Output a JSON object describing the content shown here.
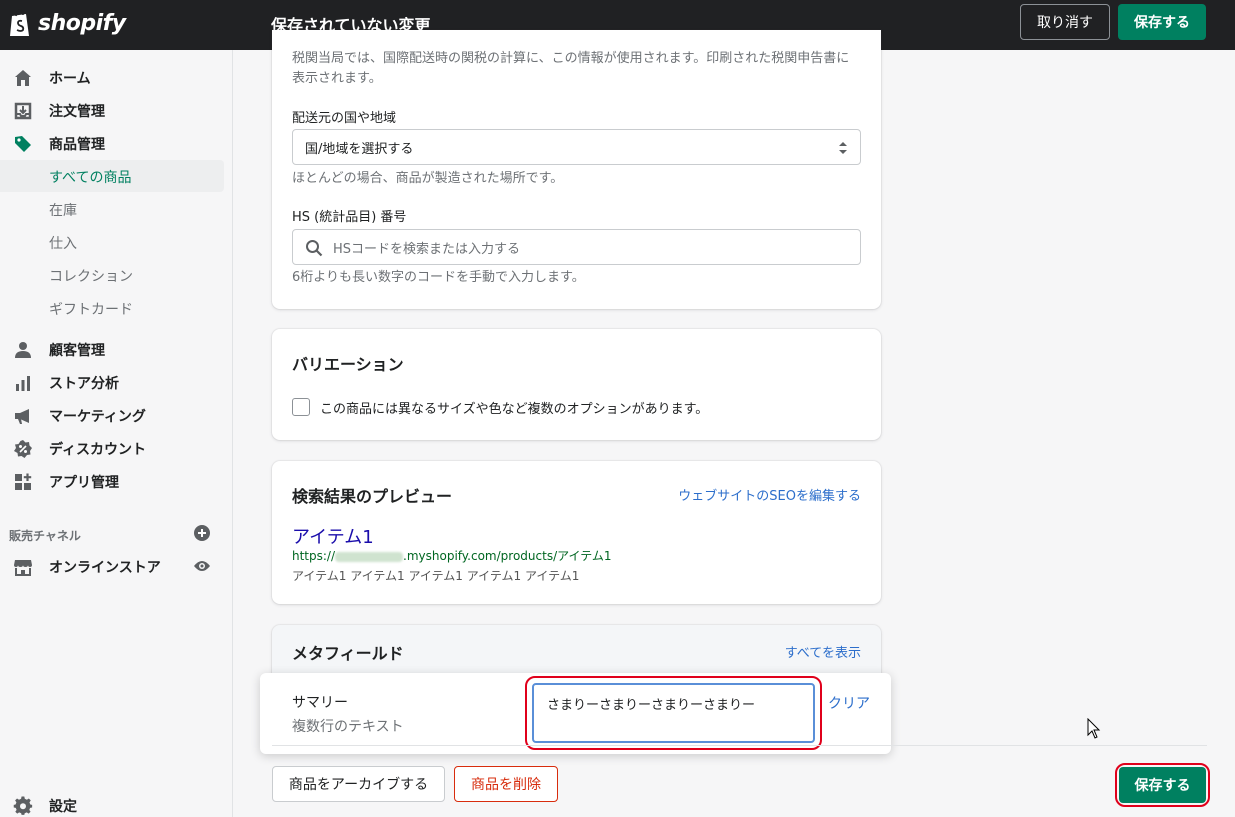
{
  "topbar": {
    "logo_text": "shopify",
    "title": "保存されていない変更",
    "discard_label": "取り消す",
    "save_label": "保存する"
  },
  "sidebar": {
    "items": [
      {
        "label": "ホーム",
        "icon": "home-icon"
      },
      {
        "label": "注文管理",
        "icon": "orders-icon"
      },
      {
        "label": "商品管理",
        "icon": "tag-icon"
      }
    ],
    "product_subitems": [
      {
        "label": "すべての商品",
        "active": true
      },
      {
        "label": "在庫"
      },
      {
        "label": "仕入"
      },
      {
        "label": "コレクション"
      },
      {
        "label": "ギフトカード"
      }
    ],
    "items2": [
      {
        "label": "顧客管理",
        "icon": "customer-icon"
      },
      {
        "label": "ストア分析",
        "icon": "analytics-icon"
      },
      {
        "label": "マーケティング",
        "icon": "megaphone-icon"
      },
      {
        "label": "ディスカウント",
        "icon": "discount-icon"
      },
      {
        "label": "アプリ管理",
        "icon": "apps-icon"
      }
    ],
    "channels_heading": "販売チャネル",
    "online_store": "オンラインストア",
    "settings": "設定"
  },
  "customs": {
    "note": "税関当局では、国際配送時の関税の計算に、この情報が使用されます。印刷された税関申告書に表示されます。",
    "origin_label": "配送元の国や地域",
    "origin_value": "国/地域を選択する",
    "origin_help": "ほとんどの場合、商品が製造された場所です。",
    "hs_label": "HS (統計品目) 番号",
    "hs_placeholder": "HSコードを検索または入力する",
    "hs_help": "6桁よりも長い数字のコードを手動で入力します。"
  },
  "variants": {
    "title": "バリエーション",
    "checkbox_label": "この商品には異なるサイズや色など複数のオプションがあります。",
    "checked": false
  },
  "seo": {
    "title": "検索結果のプレビュー",
    "edit_link": "ウェブサイトのSEOを編集する",
    "page_title": "アイテム1",
    "url_prefix": "https://",
    "url_suffix": ".myshopify.com/products/アイテム1",
    "description": "アイテム1 アイテム1 アイテム1 アイテム1 アイテム1"
  },
  "metafields": {
    "title": "メタフィールド",
    "show_all": "すべてを表示",
    "field_name": "サマリー",
    "field_type": "複数行のテキスト",
    "field_value": "さまりーさまりーさまりーさまりー",
    "clear_label": "クリア"
  },
  "footer": {
    "archive_label": "商品をアーカイブする",
    "delete_label": "商品を削除",
    "save_label": "保存する"
  },
  "colors": {
    "primary": "#008060",
    "topbar": "#202123",
    "link": "#2c6ecb",
    "danger": "#d72c0d",
    "highlight_ring": "#e0001b"
  }
}
